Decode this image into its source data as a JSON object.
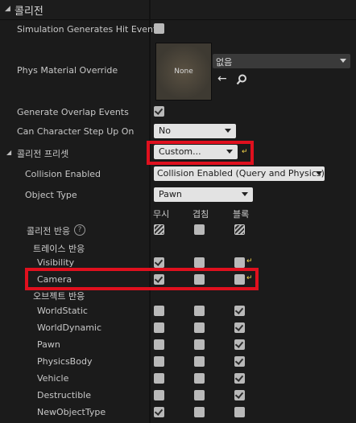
{
  "section": {
    "title": "콜리전"
  },
  "rows": {
    "sim_hit": {
      "label": "Simulation Generates Hit Events"
    },
    "phys_mat": {
      "label": "Phys Material Override",
      "thumb_text": "None",
      "combo_value": "없음"
    },
    "gen_overlap": {
      "label": "Generate Overlap Events"
    },
    "step_up": {
      "label": "Can Character Step Up On",
      "value": "No"
    },
    "preset": {
      "label": "콜리전 프리셋",
      "value": "Custom..."
    },
    "enabled": {
      "label": "Collision Enabled",
      "value": "Collision Enabled (Query and Physics)"
    },
    "object_type": {
      "label": "Object Type",
      "value": "Pawn"
    }
  },
  "response": {
    "columns": [
      "무시",
      "겹침",
      "블록"
    ],
    "header": "콜리전 반응",
    "trace_header": "트레이스 반응",
    "object_header": "오브젝트 반응",
    "trace": [
      {
        "name": "Visibility",
        "state": "ignore"
      },
      {
        "name": "Camera",
        "state": "ignore"
      }
    ],
    "object": [
      {
        "name": "WorldStatic",
        "state": "block"
      },
      {
        "name": "WorldDynamic",
        "state": "block"
      },
      {
        "name": "Pawn",
        "state": "block"
      },
      {
        "name": "PhysicsBody",
        "state": "block"
      },
      {
        "name": "Vehicle",
        "state": "block"
      },
      {
        "name": "Destructible",
        "state": "block"
      },
      {
        "name": "NewObjectType",
        "state": "ignore"
      }
    ]
  },
  "colors": {
    "highlight": "#e0101e",
    "reset_arrow": "#f4d64a"
  }
}
